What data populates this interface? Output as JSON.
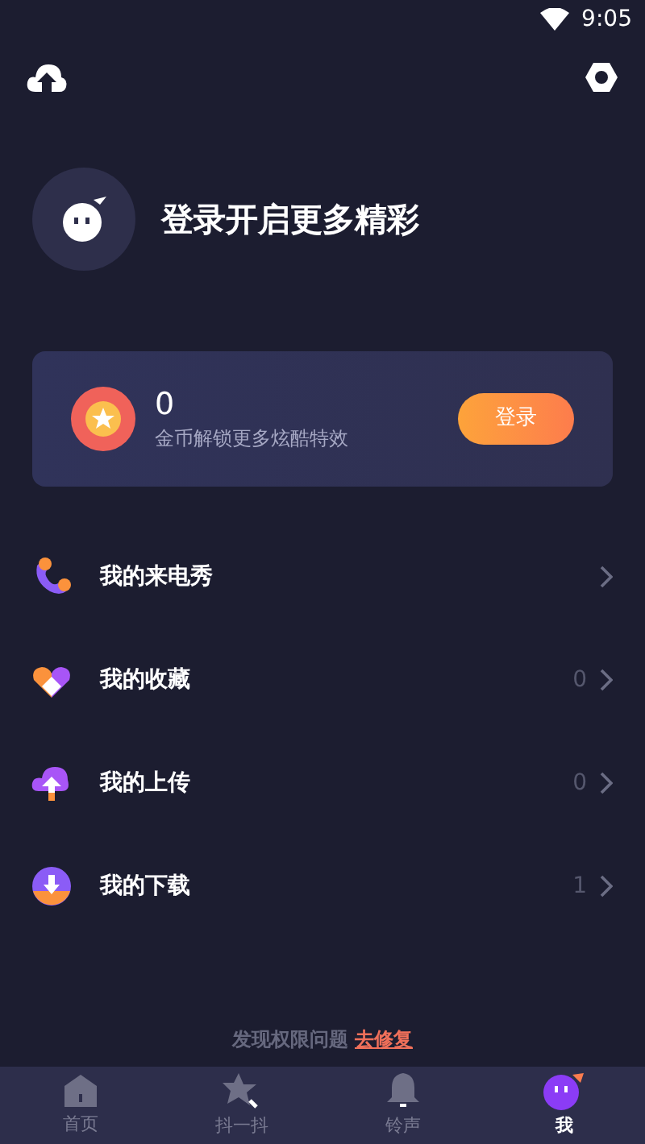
{
  "status_bar": {
    "time": "9:05"
  },
  "profile": {
    "title": "登录开启更多精彩"
  },
  "coin_card": {
    "amount": "0",
    "caption": "金币解锁更多炫酷特效",
    "button": "登录"
  },
  "menu": [
    {
      "label": "我的来电秀"
    },
    {
      "label": "我的收藏",
      "count": "0"
    },
    {
      "label": "我的上传",
      "count": "0"
    },
    {
      "label": "我的下载",
      "count": "1"
    }
  ],
  "notice": {
    "text": "发现权限问题",
    "link": "去修复"
  },
  "tabs": [
    {
      "label": "首页",
      "selected": false
    },
    {
      "label": "抖一抖",
      "selected": false
    },
    {
      "label": "铃声",
      "selected": false
    },
    {
      "label": "我",
      "selected": true
    }
  ]
}
